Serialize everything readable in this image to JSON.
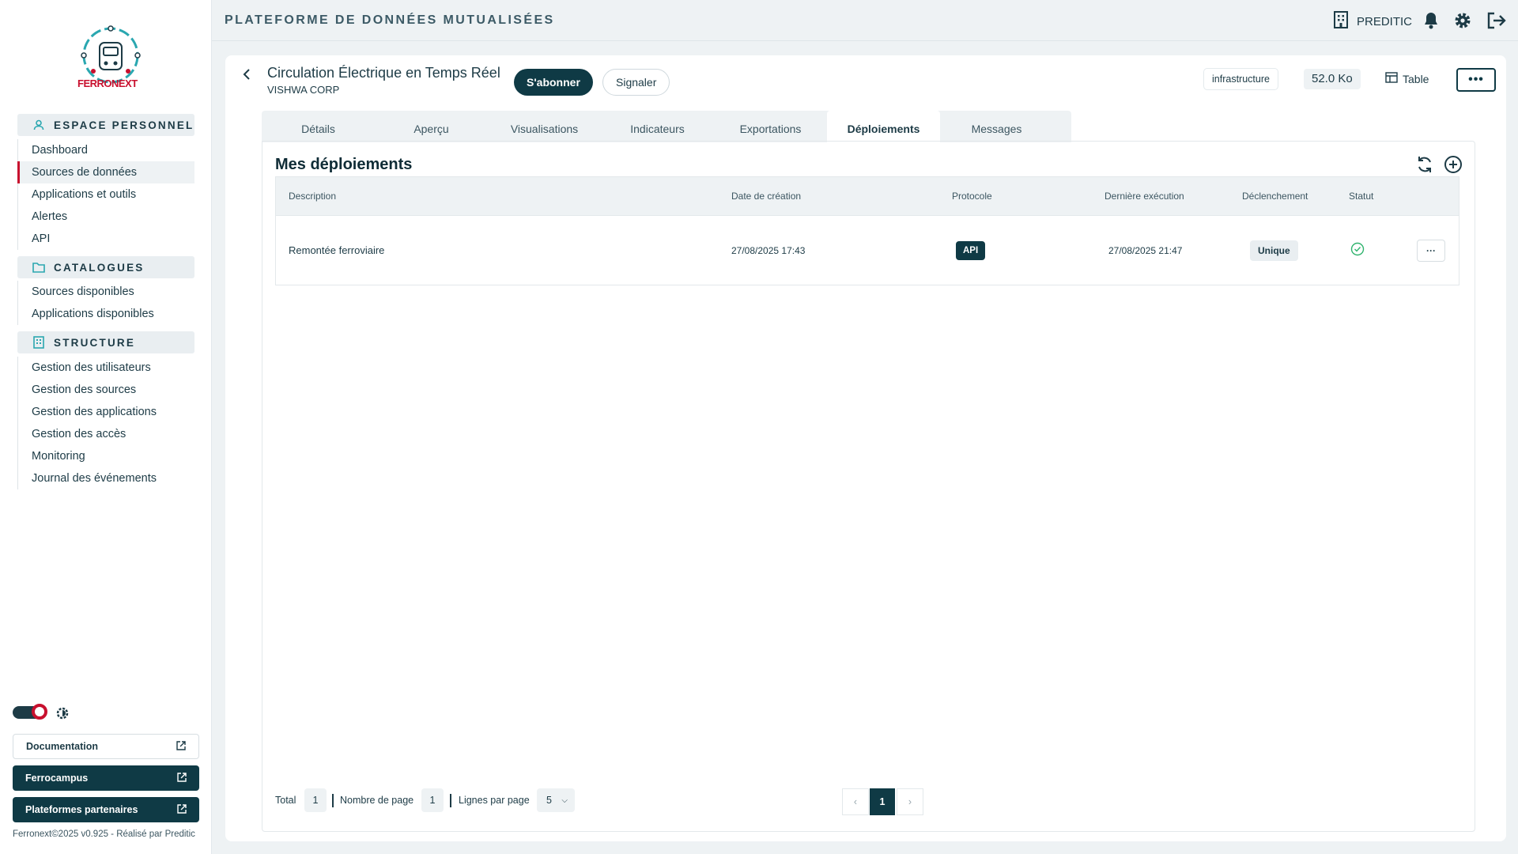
{
  "app": {
    "title": "PLATEFORME DE DONNÉES MUTUALISÉES",
    "organization": "PREDITIC",
    "logo_text": "FERRONEXT"
  },
  "sidebar": {
    "sections": [
      {
        "label": "ESPACE PERSONNEL",
        "icon": "user-icon",
        "items": [
          {
            "label": "Dashboard"
          },
          {
            "label": "Sources de données",
            "active": true
          },
          {
            "label": "Applications et outils"
          },
          {
            "label": "Alertes"
          },
          {
            "label": "API"
          }
        ]
      },
      {
        "label": "CATALOGUES",
        "icon": "folder-icon",
        "items": [
          {
            "label": "Sources disponibles"
          },
          {
            "label": "Applications disponibles"
          }
        ]
      },
      {
        "label": "STRUCTURE",
        "icon": "building-icon",
        "items": [
          {
            "label": "Gestion des utilisateurs"
          },
          {
            "label": "Gestion des sources"
          },
          {
            "label": "Gestion des applications"
          },
          {
            "label": "Gestion des accès"
          },
          {
            "label": "Monitoring"
          },
          {
            "label": "Journal des événements"
          }
        ]
      }
    ],
    "links": [
      {
        "label": "Documentation"
      },
      {
        "label": "Ferrocampus"
      },
      {
        "label": "Plateformes partenaires"
      }
    ],
    "footer": "Ferronext©2025 v0.925 - Réalisé par Preditic"
  },
  "dataset": {
    "title": "Circulation Électrique en Temps Réel",
    "owner": "VISHWA CORP",
    "subscribe_label": "S'abonner",
    "report_label": "Signaler",
    "tag": "infrastructure",
    "size": "52.0 Ko",
    "view_label": "Table",
    "more_label": "•••"
  },
  "tabs": [
    {
      "label": "Détails"
    },
    {
      "label": "Aperçu"
    },
    {
      "label": "Visualisations"
    },
    {
      "label": "Indicateurs"
    },
    {
      "label": "Exportations"
    },
    {
      "label": "Déploiements",
      "active": true
    },
    {
      "label": "Messages"
    }
  ],
  "deployments": {
    "title": "Mes déploiements",
    "columns": [
      "Description",
      "Date de création",
      "Protocole",
      "Dernière exécution",
      "Déclenchement",
      "Statut"
    ],
    "rows": [
      {
        "description": "Remontée ferroviaire",
        "created": "27/08/2025 17:43",
        "protocol": "API",
        "last_run": "27/08/2025 21:47",
        "trigger": "Unique",
        "status": "success",
        "actions_label": "···"
      }
    ]
  },
  "pagination": {
    "total_label": "Total",
    "total": "1",
    "pages_label": "Nombre de page",
    "pages": "1",
    "rows_label": "Lignes par page",
    "rows_per_page": "5",
    "current_page": "1",
    "prev": "‹",
    "next": "›"
  },
  "colors": {
    "primary": "#0f3a45",
    "accent": "#c8102e",
    "success": "#2fb36d",
    "background": "#eef2f4"
  }
}
